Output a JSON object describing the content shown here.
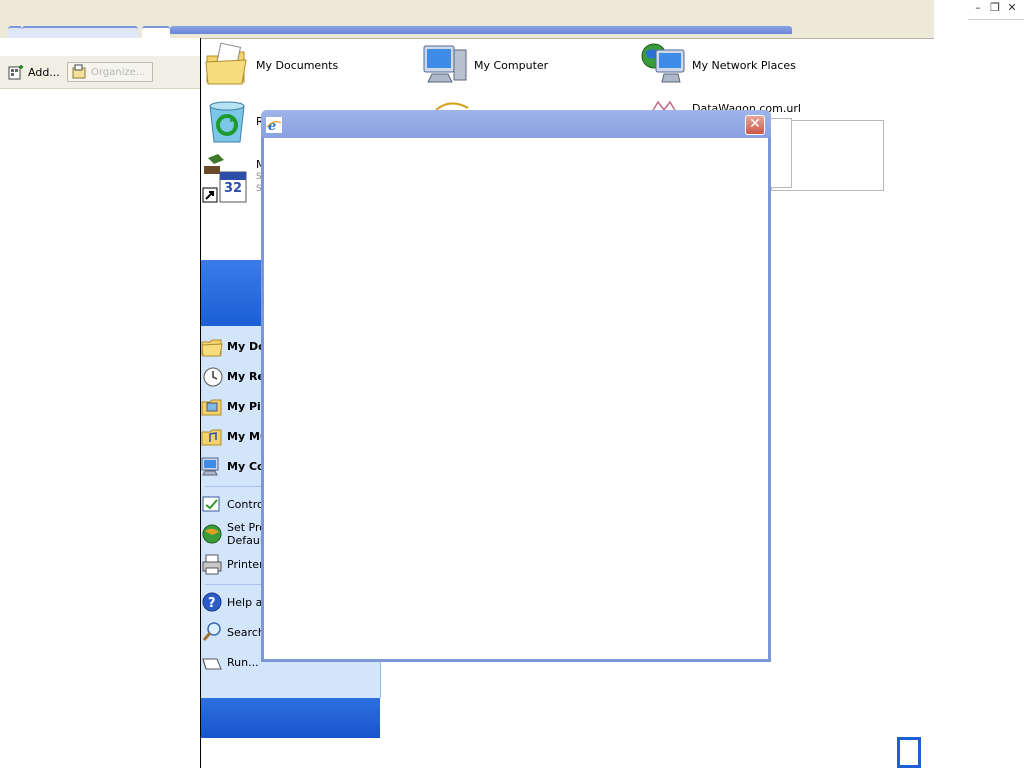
{
  "toolbar": {
    "add_label": "Add...",
    "organize_label": "Organize..."
  },
  "window_controls": {
    "minimize": "–",
    "restore": "❐",
    "close": "✕"
  },
  "desktop": {
    "items": [
      {
        "label": "My Documents",
        "icon": "my-documents-icon"
      },
      {
        "label": "My Computer",
        "icon": "my-computer-icon"
      },
      {
        "label": "My Network Places",
        "icon": "my-network-places-icon"
      },
      {
        "label": "DataWagon.com.url",
        "icon": "url-shortcut-icon"
      }
    ],
    "partial_labels": {
      "recycle": "R",
      "calendar_line1": "M",
      "calendar_line2": "S",
      "calendar_line3": "S"
    }
  },
  "start_menu": {
    "items": [
      {
        "label": "My Do",
        "bold": true,
        "icon": "my-documents-icon"
      },
      {
        "label": "My Re",
        "bold": true,
        "icon": "my-recent-documents-icon"
      },
      {
        "label": "My Pic",
        "bold": true,
        "icon": "my-pictures-icon"
      },
      {
        "label": "My Mu",
        "bold": true,
        "icon": "my-music-icon"
      },
      {
        "label": "My Co",
        "bold": true,
        "icon": "my-computer-icon"
      },
      {
        "label": "Control",
        "bold": false,
        "icon": "control-panel-icon"
      },
      {
        "label_line1": "Set Pro",
        "label_line2": "Default",
        "icon": "set-program-access-icon"
      },
      {
        "label": "Printers",
        "bold": false,
        "icon": "printers-icon"
      },
      {
        "label": "Help an",
        "bold": false,
        "icon": "help-icon"
      },
      {
        "label": "Search",
        "bold": false,
        "icon": "search-icon"
      },
      {
        "label": "Run...",
        "bold": false,
        "icon": "run-icon"
      }
    ]
  },
  "dialog": {
    "title": "",
    "icon": "internet-explorer-icon",
    "close_label": "✕"
  },
  "colors": {
    "xp_blue": "#1f5ed6",
    "dialog_frame": "#7d98d8",
    "close_red": "#c9574a",
    "start_menu_panel": "#d3e5fa"
  }
}
